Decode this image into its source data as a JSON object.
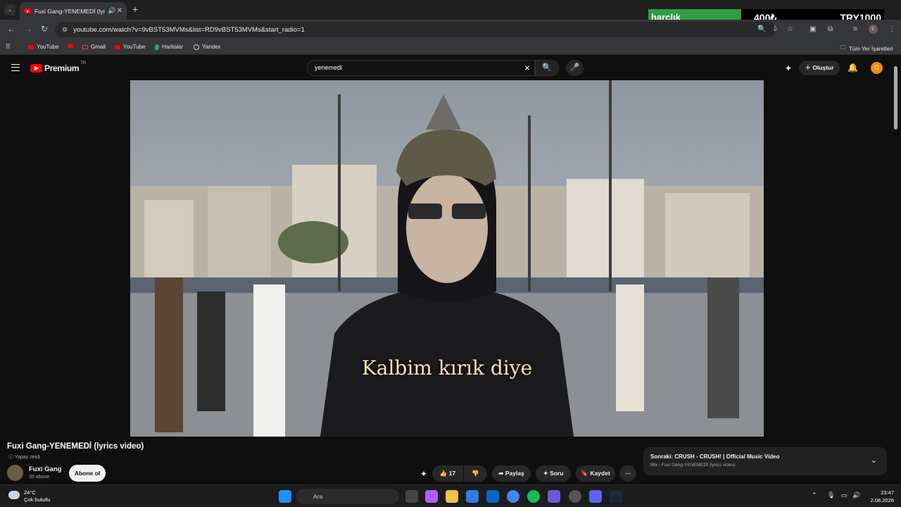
{
  "browser": {
    "tab_title": "Fuxi Gang-YENEMEDİ (lyrics",
    "tab_close": "✕",
    "new_tab": "+",
    "url": "youtube.com/watch?v=9vBST53MVMs&list=RD9vBST53MVMs&start_radio=1",
    "bookmarks": [
      {
        "label": "YouTube",
        "icon": "youtube-icon"
      },
      {
        "label": "",
        "icon": "youtube-icon"
      },
      {
        "label": "Gmail",
        "icon": "gmail-icon"
      },
      {
        "label": "YouTube",
        "icon": "youtube-icon"
      },
      {
        "label": "Haritalar",
        "icon": "maps-icon"
      },
      {
        "label": "Yandex",
        "icon": "yandex-icon"
      }
    ],
    "all_bookmarks": "Tüm Yer İşaretleri"
  },
  "overlay": {
    "left": "harçlık",
    "middle": "400₺",
    "right": "TRY1000",
    "green": "#2e9d43"
  },
  "youtube": {
    "logo_text": "Premium",
    "region": "TR",
    "search_value": "yenemedi",
    "create_label": "Oluştur",
    "avatar_letter": "G",
    "accent": "#ff0000"
  },
  "video": {
    "lyric": "Kalbim kırık diye",
    "title": "Fuxi Gang-YENEMEDİ (lyrics video)",
    "ai_label": "Yapay zekâ",
    "channel": "Fuxi Gang",
    "subscribers": "39 abone",
    "subscribe_label": "Abone ol",
    "likes": "17",
    "share_label": "Paylaş",
    "ask_label": "Soru",
    "save_label": "Kaydet"
  },
  "next_up": {
    "prefix": "Sonraki:",
    "title": "CRUSH - CRUSH! | Official Music Video",
    "mix": "Mix - Fuxi Gang-YENEMEDİ (lyrics video)"
  },
  "taskbar": {
    "temp": "24°C",
    "weather": "Çok bulutlu",
    "search_placeholder": "Ara",
    "time": "23:47",
    "date": "2.08.2026"
  }
}
